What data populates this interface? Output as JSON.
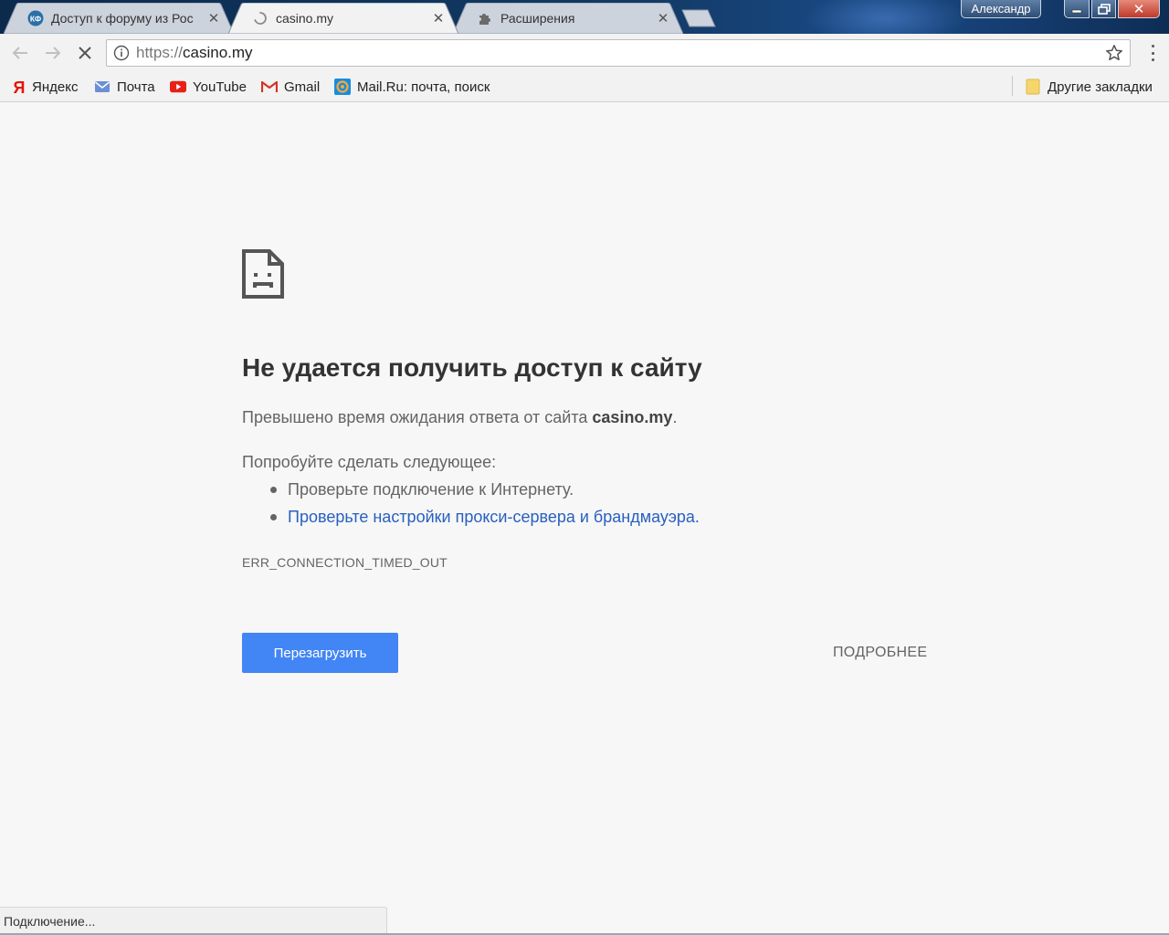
{
  "tabs": [
    {
      "title": "Доступ к форуму из Рос",
      "favicon": "kf-logo-icon",
      "active": false
    },
    {
      "title": "casino.my",
      "favicon": "loading-spinner-icon",
      "active": true
    },
    {
      "title": "Расширения",
      "favicon": "puzzle-icon",
      "active": false
    }
  ],
  "window": {
    "profile_name": "Александр"
  },
  "toolbar": {
    "url_scheme": "https://",
    "url_host": "casino.my"
  },
  "bookmarks": [
    {
      "label": "Яндекс",
      "icon": "yandex-icon"
    },
    {
      "label": "Почта",
      "icon": "mail-icon"
    },
    {
      "label": "YouTube",
      "icon": "youtube-icon"
    },
    {
      "label": "Gmail",
      "icon": "gmail-icon"
    },
    {
      "label": "Mail.Ru: почта, поиск",
      "icon": "mailru-icon"
    }
  ],
  "other_bookmarks": "Другие закладки",
  "error": {
    "title": "Не удается получить доступ к сайту",
    "desc_prefix": "Превышено время ожидания ответа от сайта ",
    "desc_host": "casino.my",
    "desc_suffix": ".",
    "try_heading": "Попробуйте сделать следующее:",
    "suggestions": [
      "Проверьте подключение к Интернету.",
      "Проверьте настройки прокси-сервера и брандмауэра."
    ],
    "code": "ERR_CONNECTION_TIMED_OUT",
    "reload_label": "Перезагрузить",
    "details_label": "ПОДРОБНЕЕ"
  },
  "status_text": "Подключение...",
  "colors": {
    "accent": "#4285f4",
    "link": "#2860c0",
    "text": "#646464"
  }
}
